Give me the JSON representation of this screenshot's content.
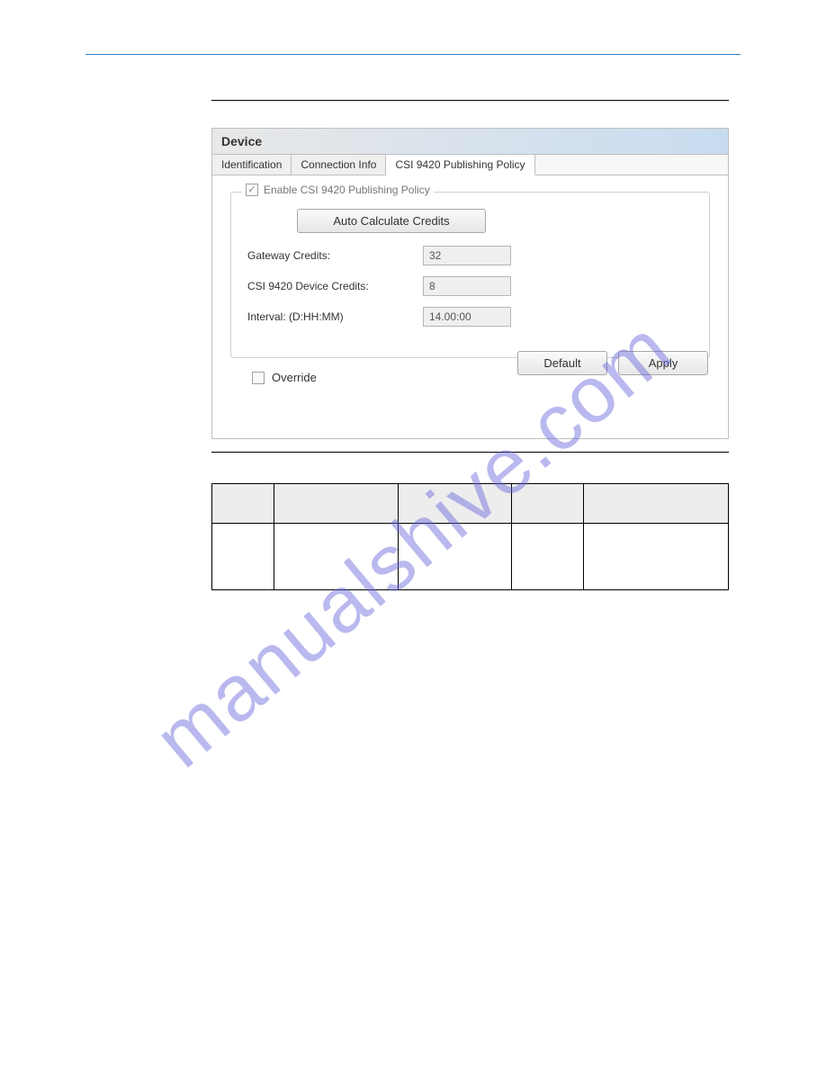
{
  "panel": {
    "title": "Device",
    "tabs": {
      "identification": "Identification",
      "connection": "Connection Info",
      "policy": "CSI 9420 Publishing Policy"
    },
    "fieldset_legend": "Enable CSI 9420 Publishing Policy",
    "auto_calc_label": "Auto Calculate Credits",
    "rows": {
      "gateway_label": "Gateway Credits:",
      "gateway_value": "32",
      "device_label": "CSI 9420 Device Credits:",
      "device_value": "8",
      "interval_label": "Interval: (D:HH:MM)",
      "interval_value": "14.00:00"
    },
    "override_label": "Override",
    "default_btn": "Default",
    "apply_btn": "Apply"
  },
  "watermark": "manualshive.com"
}
